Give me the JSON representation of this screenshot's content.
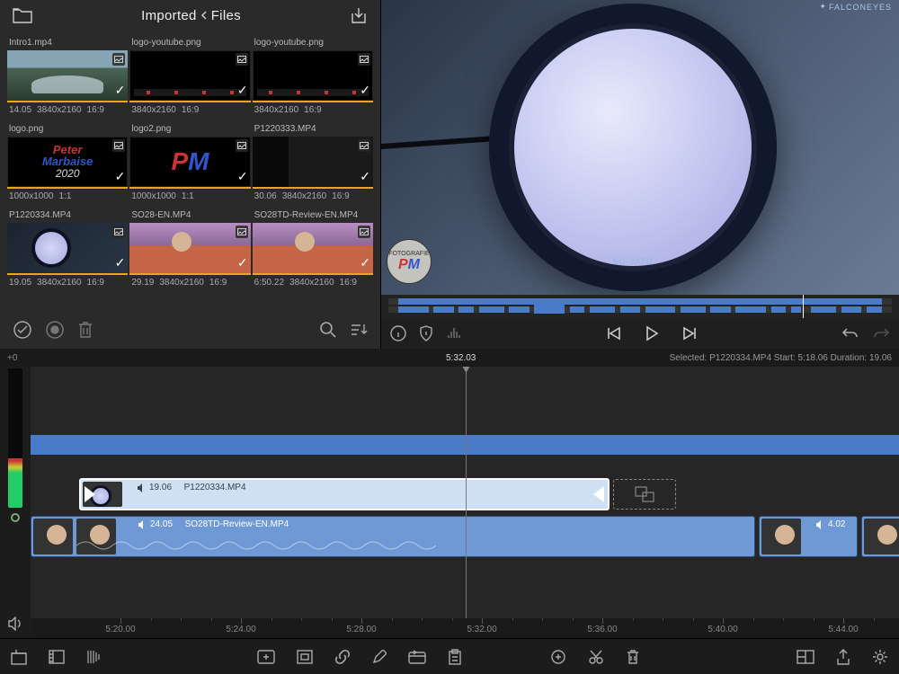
{
  "library": {
    "title_left": "Imported",
    "title_right": "Files",
    "clips": [
      {
        "name": "Intro1.mp4",
        "dur": "14.05",
        "dim": "3840x2160",
        "ar": "16:9",
        "thumb": "mtn"
      },
      {
        "name": "logo-youtube.png",
        "dur": "",
        "dim": "3840x2160",
        "ar": "16:9",
        "thumb": "ytlogo"
      },
      {
        "name": "logo-youtube.png",
        "dur": "",
        "dim": "3840x2160",
        "ar": "16:9",
        "thumb": "ytlogo"
      },
      {
        "name": "logo.png",
        "dur": "",
        "dim": "1000x1000",
        "ar": "1:1",
        "thumb": "pm2020"
      },
      {
        "name": "logo2.png",
        "dur": "",
        "dim": "1000x1000",
        "ar": "1:1",
        "thumb": "pm"
      },
      {
        "name": "P1220333.MP4",
        "dur": "30.06",
        "dim": "3840x2160",
        "ar": "16:9",
        "thumb": "device"
      },
      {
        "name": "P1220334.MP4",
        "dur": "19.05",
        "dim": "3840x2160",
        "ar": "16:9",
        "thumb": "light"
      },
      {
        "name": "SO28-EN.MP4",
        "dur": "29.19",
        "dim": "3840x2160",
        "ar": "16:9",
        "thumb": "person"
      },
      {
        "name": "SO28TD-Review-EN.MP4",
        "dur": "6:50.22",
        "dim": "3840x2160",
        "ar": "16:9",
        "thumb": "person"
      }
    ]
  },
  "preview": {
    "brand": "FALCONEYES",
    "model": "SO-28TD",
    "watermark_top": "FOTOGRAFIE"
  },
  "timeline": {
    "offset_label": "+0",
    "playhead": "5:32.03",
    "selection": "Selected: P1220334.MP4 Start: 5:18.06 Duration: 19.06",
    "ruler": [
      "5:20.00",
      "5:24.00",
      "5:28.00",
      "5:32.00",
      "5:36.00",
      "5:40.00",
      "5:44.00"
    ],
    "clip1": {
      "dur": "19.06",
      "name": "P1220334.MP4"
    },
    "clip2": {
      "dur": "24.05",
      "name": "SO28TD-Review-EN.MP4"
    },
    "clip3": {
      "dur": "4.02"
    }
  }
}
